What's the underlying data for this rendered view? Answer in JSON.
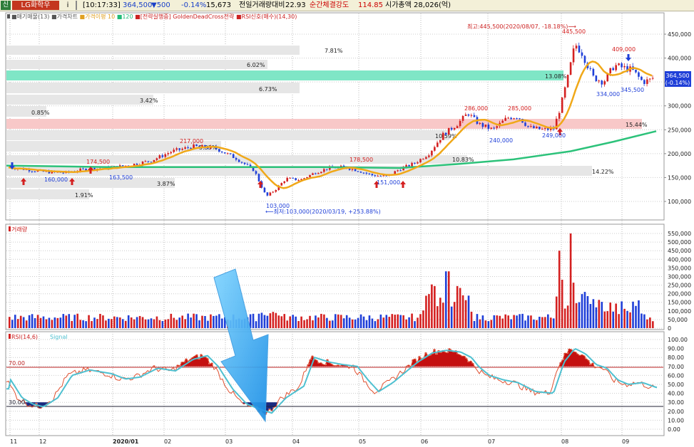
{
  "topbar": {
    "logo": "신",
    "stock_name": "LG화학우",
    "info": "i",
    "time": "[10:17:33]",
    "price": "364,500",
    "change": "▼500",
    "change_pct": "-0.14%",
    "volume": "15,673",
    "volume_ratio_label": "전일거래량대비",
    "volume_ratio": "22.93",
    "strength_label": "순간체결강도",
    "strength": "114.85",
    "market_cap": "시가총액 28,026(억)"
  },
  "price_panel": {
    "legend": [
      "매기매물(13)",
      "가격차트",
      "가격이평 10",
      "120",
      "[전략실행중] GoldenDeadCross전략",
      "RSI신호(매수)(14,30)"
    ],
    "legend_colors": [
      "#555555",
      "#555555",
      "#e0a020",
      "#22bb77",
      "#cc2222",
      "#cc2222"
    ],
    "current_price": "364,500",
    "current_change": "(-0.14%)",
    "ylabels": [
      "450,000",
      "400,000",
      "350,000",
      "300,000",
      "250,000",
      "200,000",
      "150,000",
      "100,000"
    ],
    "profile_labels": [
      "7.81%",
      "6.02%",
      "13.08%",
      "6.73%",
      "3.42%",
      "0.85%",
      "15.44%",
      "10.59%",
      "5.33%",
      "10.83%",
      "14.22%",
      "3.87%",
      "1.91%"
    ],
    "price_labels": [
      "445,500",
      "409,000",
      "334,000",
      "345,500",
      "286,000",
      "285,000",
      "240,000",
      "249,000",
      "217,000",
      "174,500",
      "160,000",
      "163,500",
      "178,500",
      "151,000",
      "103,000"
    ],
    "max_note": "최고:445,500(2020/08/07, -18.18%)⟶",
    "min_note": "⟵최저:103,000(2020/03/19, +253.88%)"
  },
  "volume_panel": {
    "legend": "거래량",
    "ylabels": [
      "550,000",
      "500,000",
      "450,000",
      "400,000",
      "350,000",
      "300,000",
      "250,000",
      "200,000",
      "150,000",
      "100,000",
      "50,000",
      "0"
    ]
  },
  "rsi_panel": {
    "legend": "RSI(14,6)",
    "legend2": "Signal",
    "ylabels": [
      "100.00",
      "90.00",
      "80.00",
      "70.00",
      "60.00",
      "50.00",
      "40.00",
      "30.00",
      "20.00",
      "10.00",
      "0.00"
    ],
    "upper_label": "70.00",
    "lower_label": "30.00"
  },
  "xaxis": [
    "11",
    "12",
    "2020/01",
    "02",
    "03",
    "04",
    "05",
    "06",
    "07",
    "08",
    "09"
  ],
  "chart_data": {
    "type": "candlestick",
    "title": "LG화학우",
    "x": [
      "2019-11",
      "2019-12",
      "2020-01",
      "2020-02",
      "2020-03",
      "2020-04",
      "2020-05",
      "2020-06",
      "2020-07",
      "2020-08",
      "2020-09"
    ],
    "close_approx": [
      168000,
      160000,
      178000,
      205000,
      120000,
      150000,
      155000,
      270000,
      250000,
      400000,
      355000
    ],
    "high": 445500,
    "high_date": "2020/08/07",
    "low": 103000,
    "low_date": "2020/03/19",
    "current": 364500,
    "ylim": [
      60000,
      480000
    ],
    "rsi": {
      "upper": 70,
      "lower": 30,
      "ylim": [
        0,
        100
      ]
    },
    "volume_ylim": [
      0,
      550000
    ]
  },
  "colors": {
    "up": "#d42020",
    "down": "#1f3fd8",
    "ma10": "#f0a818",
    "ma120": "#2cc27a",
    "rsi": "#4ec0d0",
    "signal": "#e05030",
    "bg": "#ffffff"
  }
}
